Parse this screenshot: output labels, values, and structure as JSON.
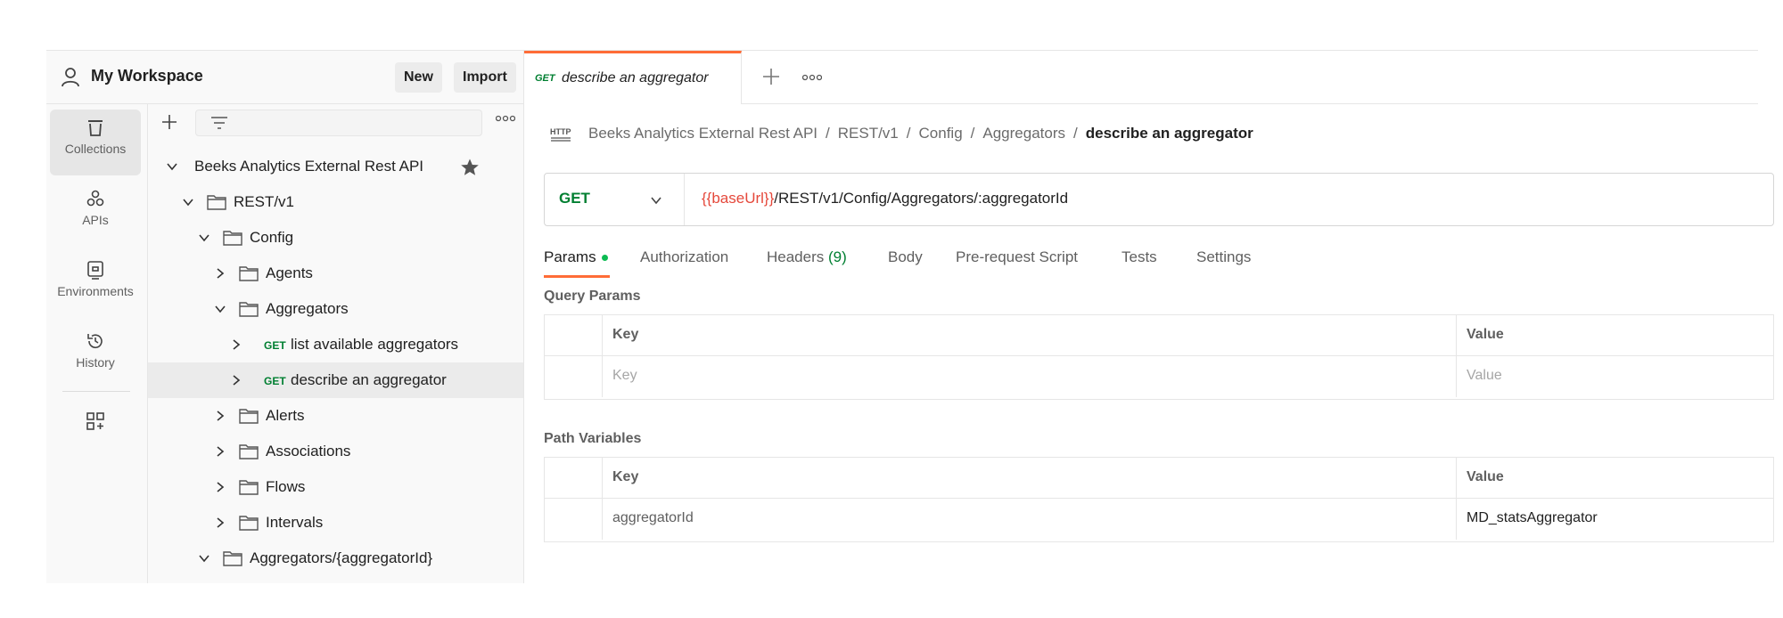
{
  "workspace": {
    "title": "My Workspace",
    "new_label": "New",
    "import_label": "Import"
  },
  "rail": {
    "collections": "Collections",
    "apis": "APIs",
    "environments": "Environments",
    "history": "History"
  },
  "tree": {
    "collection": "Beeks Analytics External Rest API",
    "items": [
      {
        "label": "REST/v1"
      },
      {
        "label": "Config"
      },
      {
        "label": "Agents"
      },
      {
        "label": "Aggregators"
      },
      {
        "method": "GET",
        "label": "list available aggregators"
      },
      {
        "method": "GET",
        "label": "describe an aggregator"
      },
      {
        "label": "Alerts"
      },
      {
        "label": "Associations"
      },
      {
        "label": "Flows"
      },
      {
        "label": "Intervals"
      },
      {
        "label": "Aggregators/{aggregatorId}"
      }
    ]
  },
  "tab": {
    "method": "GET",
    "name": "describe an aggregator"
  },
  "breadcrumb": [
    "Beeks Analytics External Rest API",
    "REST/v1",
    "Config",
    "Aggregators",
    "describe an aggregator"
  ],
  "request": {
    "method": "GET",
    "url_var": "{{baseUrl}}",
    "url_path": "/REST/v1/Config/Aggregators/:aggregatorId"
  },
  "req_tabs": {
    "params": "Params",
    "authorization": "Authorization",
    "headers": "Headers",
    "headers_count": "(9)",
    "body": "Body",
    "prerequest": "Pre-request Script",
    "tests": "Tests",
    "settings": "Settings"
  },
  "query_params": {
    "title": "Query Params",
    "key_header": "Key",
    "value_header": "Value",
    "key_placeholder": "Key",
    "value_placeholder": "Value"
  },
  "path_variables": {
    "title": "Path Variables",
    "key_header": "Key",
    "value_header": "Value",
    "rows": [
      {
        "key": "aggregatorId",
        "value": "MD_statsAggregator"
      }
    ]
  },
  "colors": {
    "accent": "#ff6c37",
    "get_method": "#007f31",
    "variable": "#e5483b"
  }
}
